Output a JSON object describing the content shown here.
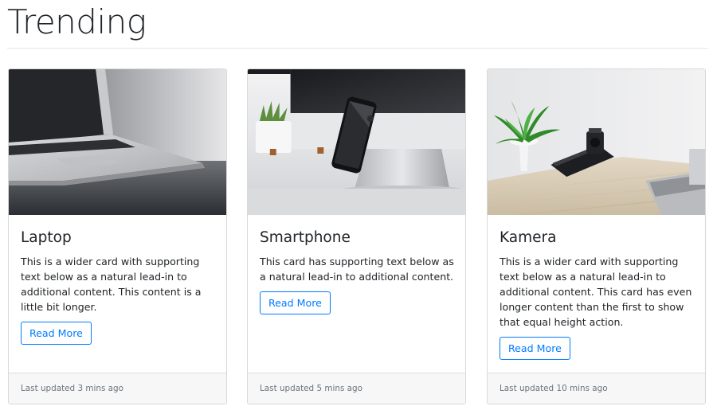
{
  "page": {
    "title": "Trending"
  },
  "cards": [
    {
      "title": "Laptop",
      "text": "This is a wider card with supporting text below as a natural lead-in to additional content. This content is a little bit longer.",
      "button_label": "Read More",
      "footer": "Last updated 3 mins ago",
      "image_icon": "laptop-photo"
    },
    {
      "title": "Smartphone",
      "text": "This card has supporting text below as a natural lead-in to additional content.",
      "button_label": "Read More",
      "footer": "Last updated 5 mins ago",
      "image_icon": "smartphone-photo"
    },
    {
      "title": "Kamera",
      "text": "This is a wider card with supporting text below as a natural lead-in to additional content. This card has even longer content than the first to show that equal height action.",
      "button_label": "Read More",
      "footer": "Last updated 10 mins ago",
      "image_icon": "camera-desk-photo"
    }
  ],
  "colors": {
    "accent": "#007bff",
    "muted_text": "#6c757d",
    "footer_bg": "#f7f7f7",
    "border": "#d9d9d9"
  }
}
